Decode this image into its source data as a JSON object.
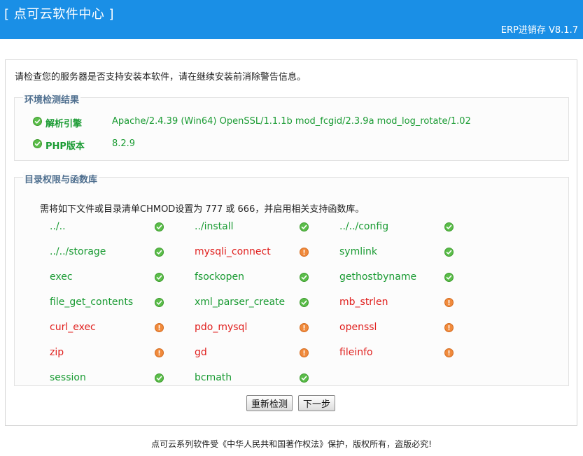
{
  "header": {
    "brand": "[ 点可云软件中心 ]",
    "version": "ERP进销存 V8.1.7",
    "color": "#1a8fe6"
  },
  "intro": "请检查您的服务器是否支持安装本软件，请在继续安装前消除警告信息。",
  "environment": {
    "title": "环境检测结果",
    "items": [
      {
        "label": "解析引擎",
        "value": "Apache/2.4.39 (Win64) OpenSSL/1.1.1b mod_fcgid/2.3.9a mod_log_rotate/1.02",
        "status": "ok"
      },
      {
        "label": "PHP版本",
        "value": "8.2.9",
        "status": "ok"
      }
    ]
  },
  "permissions": {
    "title": "目录权限与函数库",
    "note": "需将如下文件或目录清单CHMOD设置为 777 或 666，并启用相关支持函数库。",
    "items": [
      {
        "name": "../..",
        "status": "ok"
      },
      {
        "name": "../install",
        "status": "ok"
      },
      {
        "name": "../../config",
        "status": "ok"
      },
      {
        "name": "../../storage",
        "status": "ok"
      },
      {
        "name": "mysqli_connect",
        "status": "warn"
      },
      {
        "name": "symlink",
        "status": "ok"
      },
      {
        "name": "exec",
        "status": "ok"
      },
      {
        "name": "fsockopen",
        "status": "ok"
      },
      {
        "name": "gethostbyname",
        "status": "ok"
      },
      {
        "name": "file_get_contents",
        "status": "ok"
      },
      {
        "name": "xml_parser_create",
        "status": "ok"
      },
      {
        "name": "mb_strlen",
        "status": "warn"
      },
      {
        "name": "curl_exec",
        "status": "warn"
      },
      {
        "name": "pdo_mysql",
        "status": "warn"
      },
      {
        "name": "openssl",
        "status": "warn"
      },
      {
        "name": "zip",
        "status": "warn"
      },
      {
        "name": "gd",
        "status": "warn"
      },
      {
        "name": "fileinfo",
        "status": "warn"
      },
      {
        "name": "session",
        "status": "ok"
      },
      {
        "name": "bcmath",
        "status": "ok"
      }
    ]
  },
  "buttons": {
    "recheck": "重新检测",
    "next": "下一步"
  },
  "footer": "点可云系列软件受《中华人民共和国著作权法》保护，版权所有，盗版必究!",
  "colors": {
    "ok": "#1a9b33",
    "warn": "#e0201e",
    "section_title": "#4f6f8f"
  }
}
